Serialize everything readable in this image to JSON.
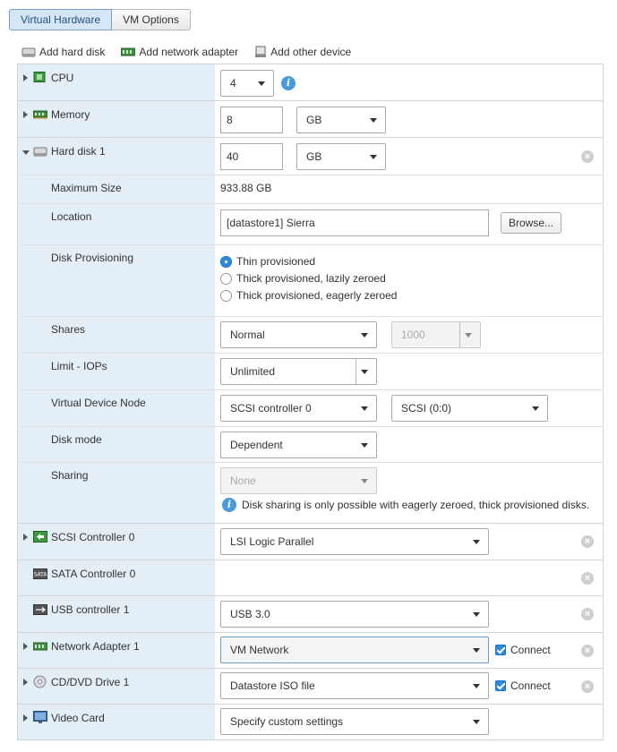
{
  "tabs": [
    {
      "label": "Virtual Hardware",
      "active": true
    },
    {
      "label": "VM Options",
      "active": false
    }
  ],
  "toolbar": {
    "add_hard_disk": "Add hard disk",
    "add_network_adapter": "Add network adapter",
    "add_other_device": "Add other device"
  },
  "cpu": {
    "label": "CPU",
    "value": "4"
  },
  "memory": {
    "label": "Memory",
    "value": "8",
    "unit": "GB"
  },
  "hard_disk": {
    "label": "Hard disk 1",
    "size": "40",
    "unit": "GB",
    "maximum_size_label": "Maximum Size",
    "maximum_size_value": "933.88 GB",
    "location_label": "Location",
    "location_value": "[datastore1] Sierra",
    "browse_label": "Browse...",
    "provisioning_label": "Disk Provisioning",
    "provisioning_options": [
      {
        "label": "Thin provisioned",
        "selected": true
      },
      {
        "label": "Thick provisioned, lazily zeroed",
        "selected": false
      },
      {
        "label": "Thick provisioned, eagerly zeroed",
        "selected": false
      }
    ],
    "shares_label": "Shares",
    "shares_value": "Normal",
    "shares_number": "1000",
    "limit_label": "Limit - IOPs",
    "limit_value": "Unlimited",
    "vdn_label": "Virtual Device Node",
    "vdn_controller": "SCSI controller 0",
    "vdn_slot": "SCSI (0:0)",
    "disk_mode_label": "Disk mode",
    "disk_mode_value": "Dependent",
    "sharing_label": "Sharing",
    "sharing_value": "None",
    "sharing_note": "Disk sharing is only possible with eagerly zeroed, thick provisioned disks."
  },
  "scsi": {
    "label": "SCSI Controller 0",
    "value": "LSI Logic Parallel"
  },
  "sata": {
    "label": "SATA Controller 0"
  },
  "usb": {
    "label": "USB controller 1",
    "value": "USB 3.0"
  },
  "network": {
    "label": "Network Adapter 1",
    "value": "VM Network",
    "connect_label": "Connect"
  },
  "cddvd": {
    "label": "CD/DVD Drive 1",
    "value": "Datastore ISO file",
    "connect_label": "Connect"
  },
  "video": {
    "label": "Video Card",
    "value": "Specify custom settings"
  },
  "colors": {
    "accent": "#2d8ae0",
    "label_bg": "#e3eef7",
    "tab_active_bg": "#d5e7f7"
  }
}
